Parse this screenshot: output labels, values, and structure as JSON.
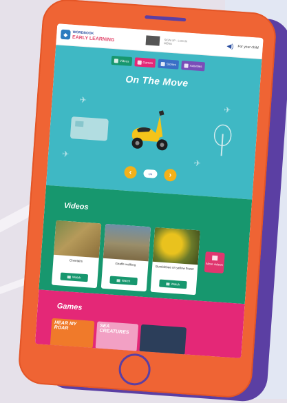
{
  "header": {
    "logo_line1": "WORDBOOK",
    "logo_line2": "EARLY LEARNING",
    "tiny_line1": "SIGN UP · LOG IN",
    "tiny_line2": "MENU",
    "parents_label": "For your child"
  },
  "nav": {
    "videos": "Videos",
    "games": "Games",
    "stories": "Stories",
    "activities": "Activities"
  },
  "hero": {
    "title": "On The Move",
    "pager": "1/4",
    "prev": "‹",
    "next": "›"
  },
  "videos": {
    "title": "Videos",
    "items": [
      {
        "caption": "Cheetahs",
        "watch": "Watch"
      },
      {
        "caption": "Giraffe walking",
        "watch": "Watch"
      },
      {
        "caption": "Bumblebee on yellow flower",
        "watch": "Watch"
      }
    ],
    "more": "More videos"
  },
  "games": {
    "title": "Games",
    "items": [
      {
        "title": "HEAR MY ROAR"
      },
      {
        "title": "SEA CREATURES"
      }
    ]
  },
  "colors": {
    "phone": "#ef6434",
    "phone_shadow": "#5b3fa3",
    "hero_bg": "#3fb8c4",
    "videos_bg": "#17976e",
    "games_bg": "#e42877",
    "accent_yellow": "#f3b11a"
  }
}
